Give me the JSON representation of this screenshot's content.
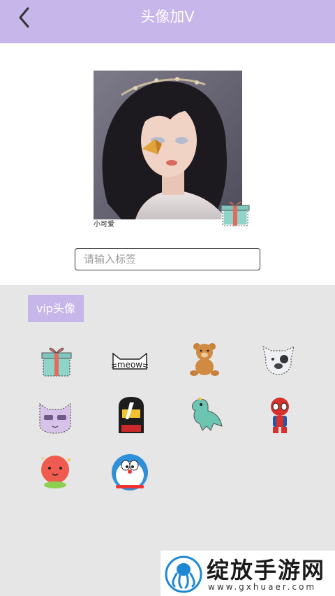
{
  "header": {
    "title": "头像加V",
    "back_icon": "chevron-left-icon",
    "color": "#c6b6ea"
  },
  "preview": {
    "caption": "小可爱",
    "badge_icon": "gift-box-icon"
  },
  "tag_input": {
    "placeholder": "请输入标签",
    "value": ""
  },
  "vip_section": {
    "label": "vip头像",
    "stickers": [
      {
        "icon": "gift-box-icon"
      },
      {
        "icon": "meow-cat-icon"
      },
      {
        "icon": "teddy-bear-icon"
      },
      {
        "icon": "bulldog-icon"
      },
      {
        "icon": "cool-cat-icon"
      },
      {
        "icon": "ninja-icon"
      },
      {
        "icon": "dinosaur-icon"
      },
      {
        "icon": "spiderman-icon"
      },
      {
        "icon": "peach-icon"
      },
      {
        "icon": "doraemon-icon"
      }
    ]
  },
  "watermark": {
    "text": "绽放手游网",
    "url": "www.gxhuaer.com"
  }
}
